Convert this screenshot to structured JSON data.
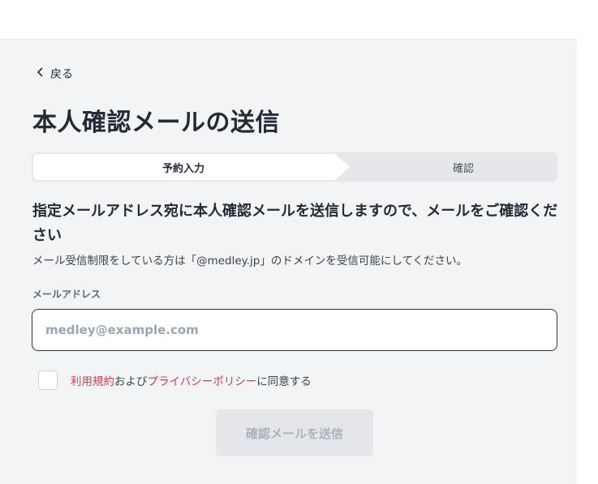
{
  "nav": {
    "back_label": "戻る"
  },
  "page_title": "本人確認メールの送信",
  "steps": [
    {
      "label": "予約入力",
      "active": true
    },
    {
      "label": "確認",
      "active": false
    }
  ],
  "lead_text": "指定メールアドレス宛に本人確認メールを送信しますので、メールをご確認ください",
  "note_text": "メール受信制限をしている方は「@medley.jp」のドメインを受信可能にしてください。",
  "form": {
    "email_label": "メールアドレス",
    "email_placeholder": "medley@example.com",
    "email_value": "",
    "agree": {
      "terms_link": "利用規約",
      "connector": "および",
      "privacy_link": "プライバシーポリシー",
      "suffix": "に同意する",
      "checked": false
    },
    "submit_label": "確認メールを送信"
  },
  "colors": {
    "link": "#d23a54",
    "panel_bg": "#f3f4f5",
    "text": "#222b36",
    "disabled_button_bg": "#e4e6e9"
  },
  "icons": {
    "back": "chevron-left-icon"
  }
}
